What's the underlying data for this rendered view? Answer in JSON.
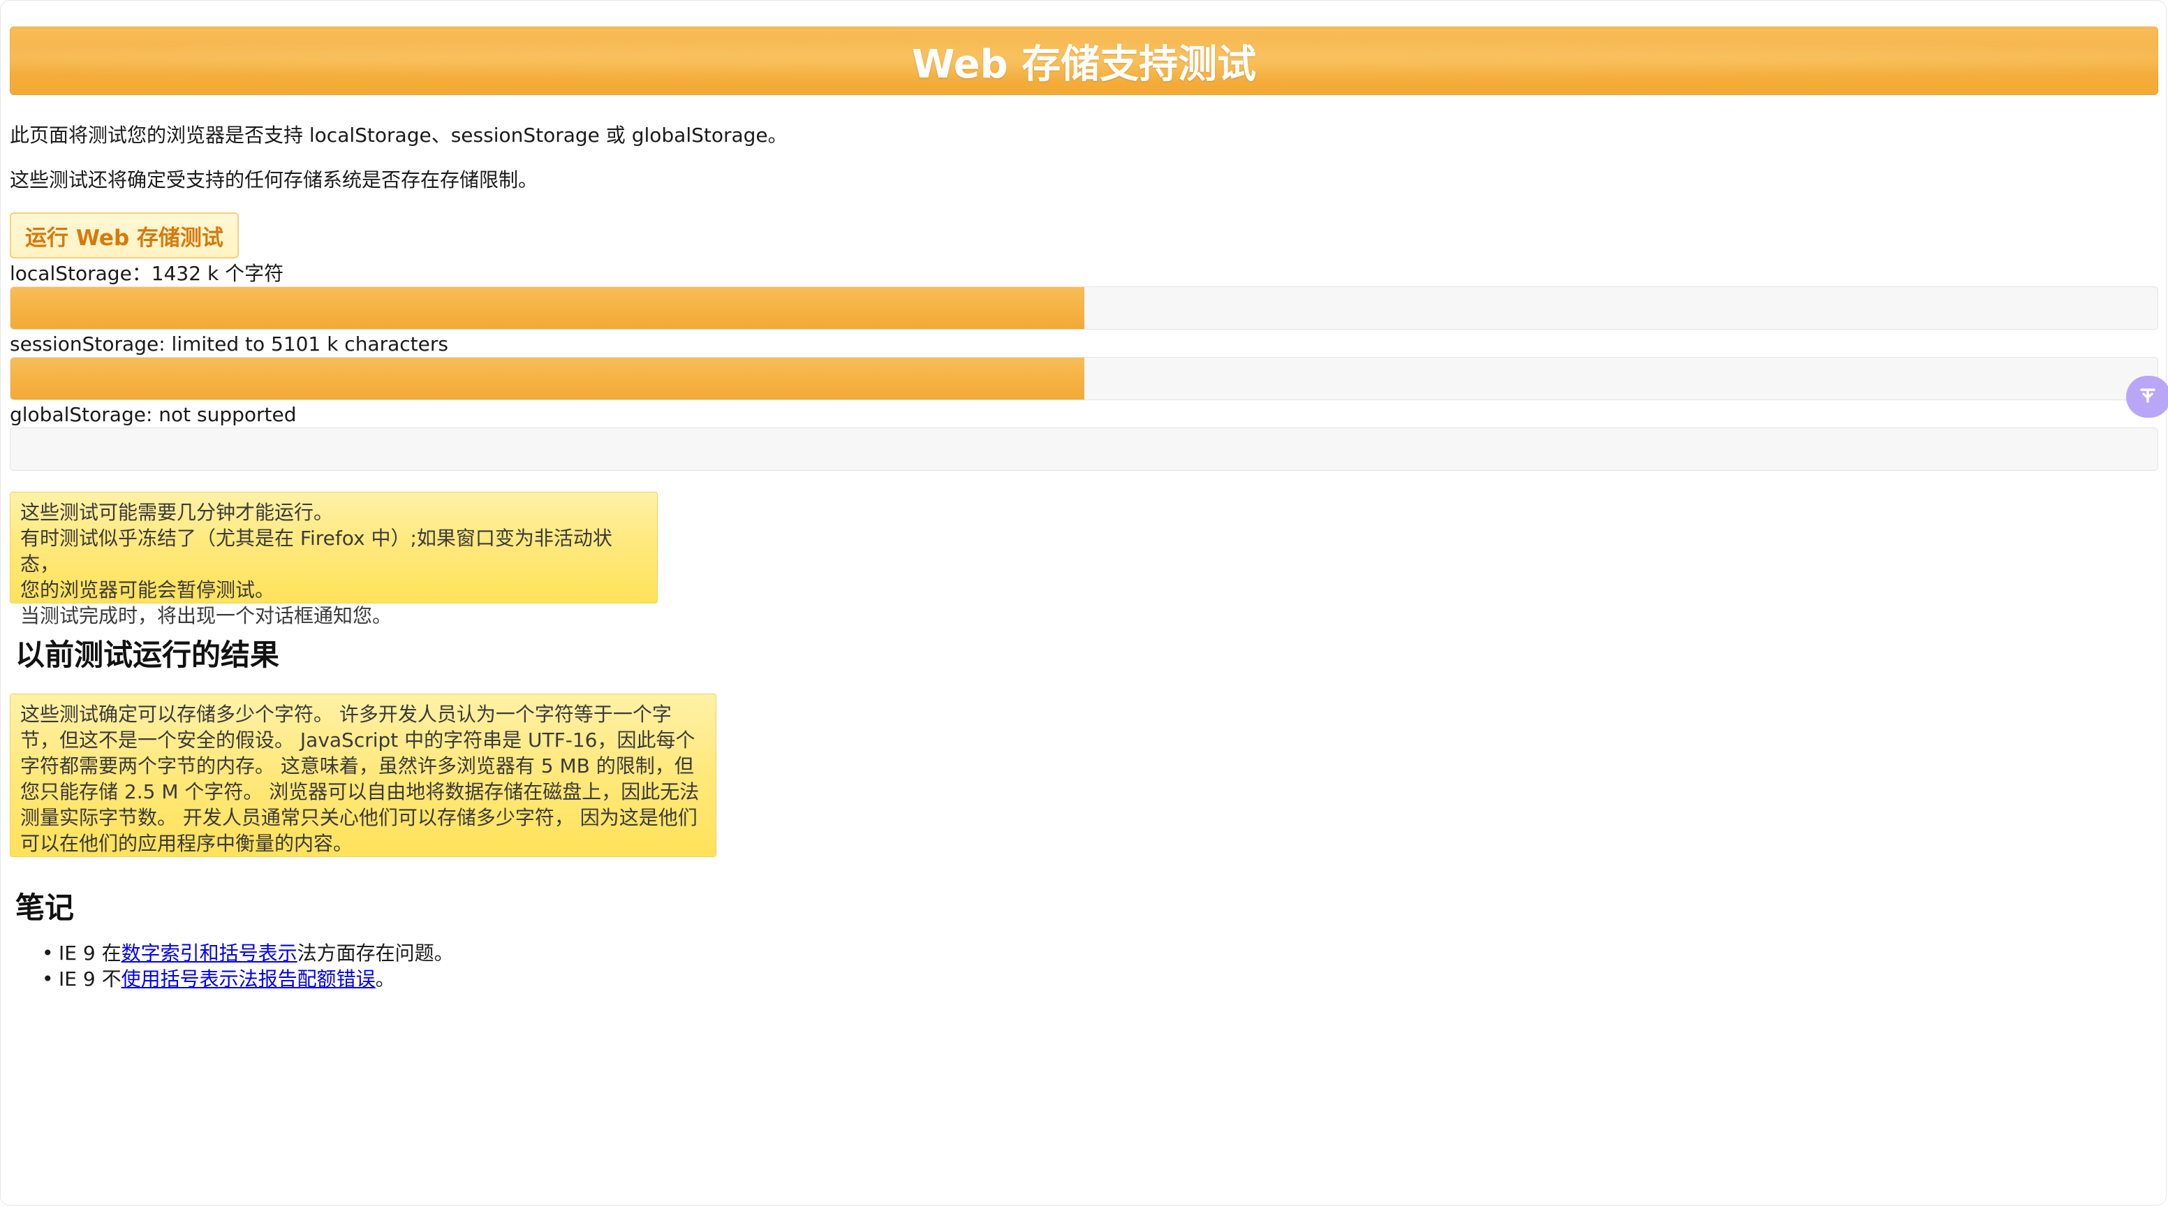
{
  "header": {
    "title": "Web 存储支持测试"
  },
  "intro": {
    "p1": "此页面将测试您的浏览器是否支持 localStorage、sessionStorage 或 globalStorage。",
    "p2": "这些测试还将确定受支持的任何存储系统是否存在存储限制。"
  },
  "run_button": {
    "label": "运行 Web 存储测试"
  },
  "storage": [
    {
      "label": "localStorage：1432 k 个字符",
      "progress": 0.5
    },
    {
      "label": "sessionStorage: limited to 5101 k characters",
      "progress": 0.5
    },
    {
      "label": "globalStorage: not supported",
      "progress": 0
    }
  ],
  "notice": {
    "lines": [
      "这些测试可能需要几分钟才能运行。",
      "有时测试似乎冻结了（尤其是在 Firefox 中）;如果窗口变为非活动状态，",
      "您的浏览器可能会暂停测试。",
      "当测试完成时，将出现一个对话框通知您。"
    ]
  },
  "previous_results": {
    "title": "以前测试运行的结果",
    "lines": [
      "这些测试确定可以存储多少个字符。 许多开发人员认为一个字符等于一个字",
      "节，但这不是一个安全的假设。 JavaScript 中的字符串是 UTF-16，因此每个",
      "字符都需要两个字节的内存。 这意味着，虽然许多浏览器有 5 MB 的限制，但",
      "您只能存储 2.5 M 个字符。 浏览器可以自由地将数据存储在磁盘上，因此无法",
      "测量实际字节数。 开发人员通常只关心他们可以存储多少字符， 因为这是他们",
      "可以在他们的应用程序中衡量的内容。"
    ]
  },
  "notes": {
    "title": "笔记",
    "items": [
      {
        "prefix": "IE 9 在",
        "link": "数字索引和括号表示",
        "suffix": "法方面存在问题。"
      },
      {
        "prefix": "IE 9 不",
        "link": "使用括号表示法报告配额错误",
        "suffix": "。"
      }
    ]
  },
  "side_widget": {
    "icon": "translate-icon",
    "color": "#b9a6f7"
  }
}
